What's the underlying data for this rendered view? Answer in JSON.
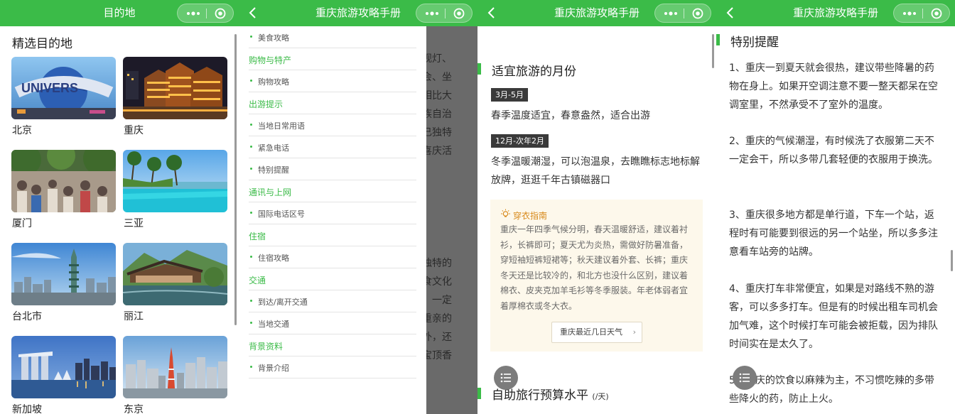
{
  "screen1": {
    "nav_title": "目的地",
    "heading": "精选目的地",
    "destinations": [
      {
        "name": "北京"
      },
      {
        "name": "重庆"
      },
      {
        "name": "厦门"
      },
      {
        "name": "三亚"
      },
      {
        "name": "台北市"
      },
      {
        "name": "丽江"
      },
      {
        "name": "新加坡"
      },
      {
        "name": "东京"
      }
    ]
  },
  "screen2": {
    "nav_title": "重庆旅游攻略手册",
    "toc": [
      {
        "type": "sub",
        "label": "美食攻略"
      },
      {
        "type": "cat",
        "label": "购物与特产"
      },
      {
        "type": "sub",
        "label": "购物攻略"
      },
      {
        "type": "cat",
        "label": "出游提示"
      },
      {
        "type": "sub",
        "label": "当地日常用语"
      },
      {
        "type": "sub",
        "label": "紧急电话"
      },
      {
        "type": "sub",
        "label": "特别提醒"
      },
      {
        "type": "cat",
        "label": "通讯与上网"
      },
      {
        "type": "sub",
        "label": "国际电话区号"
      },
      {
        "type": "cat",
        "label": "住宿"
      },
      {
        "type": "sub",
        "label": "住宿攻略"
      },
      {
        "type": "cat",
        "label": "交通"
      },
      {
        "type": "sub",
        "label": "到达/离开交通"
      },
      {
        "type": "sub",
        "label": "当地交通"
      },
      {
        "type": "cat",
        "label": "背景资料"
      },
      {
        "type": "sub",
        "label": "背景介绍"
      }
    ],
    "overlay_lines": [
      "观灯、",
      "会、坐",
      "相比大",
      "族自治",
      "已独特",
      "喜庆活",
      "独特的",
      "食文化",
      "，一定",
      "重亲的",
      "外，还",
      "宝顶香"
    ]
  },
  "screen3": {
    "nav_title": "重庆旅游攻略手册",
    "section_title": "适宜旅游的月份",
    "season1_tag": "3月-5月",
    "season1_text": "春季温度适宜，春意盎然，适合出游",
    "season2_tag": "12月-次年2月",
    "season2_text": "冬季温暖潮湿，可以泡温泉，去瞧瞧标志地标解放牌，逛逛千年古镇磁器口",
    "tip_title": "穿衣指南",
    "tip_body": "重庆一年四季气候分明，春天温暖舒适，建议着衬衫，长裤即可；夏天尤为炎热，需做好防暑准备，穿短袖短裤短裙等；秋天建议着外套、长裤；重庆冬天还是比较冷的，和北方也没什么区别，建议着棉衣、皮夹克加羊毛衫等冬季服装。年老体弱者宜着厚棉衣或冬大衣。",
    "weather_button": "重庆最近几日天气",
    "budget_title": "自助旅行预算水平",
    "budget_unit": "(/天)"
  },
  "screen4": {
    "nav_title": "重庆旅游攻略手册",
    "section_title": "特别提醒",
    "tips": [
      "1、重庆一到夏天就会很热，建议带些降暑的药物在身上。如果开空调注意不要一整天都呆在空调室里，不然承受不了室外的温度。",
      "2、重庆的气候潮湿，有时候洗了衣服第二天不一定会干，所以多带几套轻便的衣服用于换洗。",
      "3、重庆很多地方都是单行道，下车一个站，返程时有可能要到很远的另一个站坐，所以多多注意看车站旁的站牌。",
      "4、重庆打车非常便宜，如果是对路线不熟的游客，可以多多打车。但是有的时候出租车司机会加气难，这个时候打车可能会被拒载，因为排队时间实在是太久了。",
      "5、重庆的饮食以麻辣为主，不习惯吃辣的多带些降火的药，防止上火。"
    ]
  }
}
